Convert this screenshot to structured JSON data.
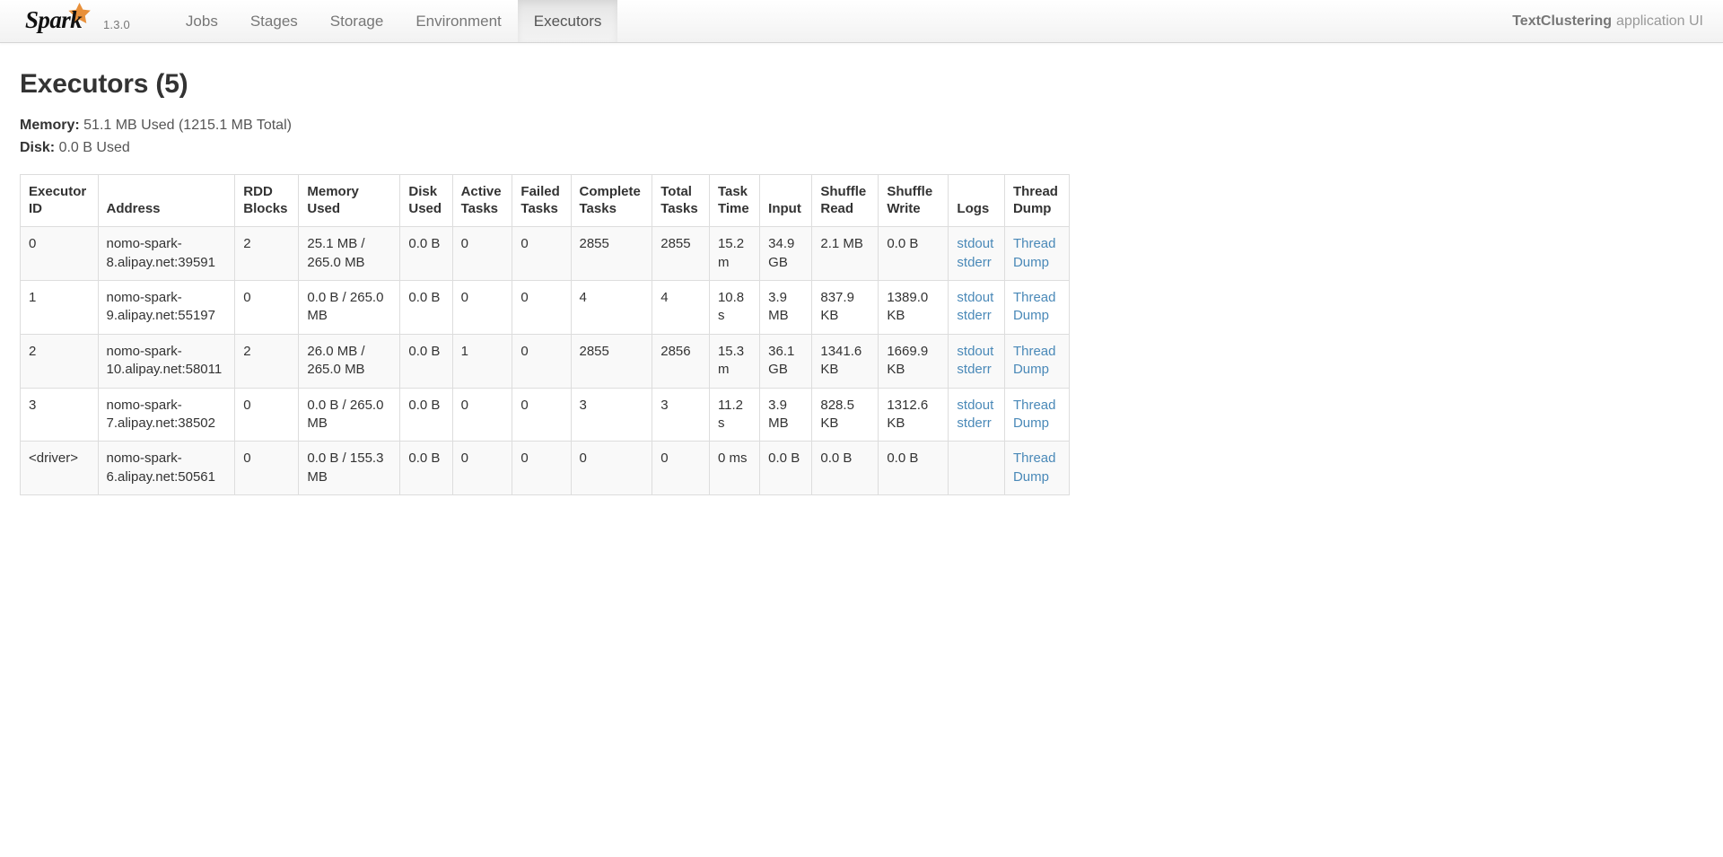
{
  "navbar": {
    "brand": {
      "name": "Spark",
      "version": "1.3.0",
      "logo_icon": "spark-star-logo",
      "star_color": "#e8903a",
      "wordmark_color": "#1a1a1a"
    },
    "tabs": [
      {
        "label": "Jobs",
        "active": false
      },
      {
        "label": "Stages",
        "active": false
      },
      {
        "label": "Storage",
        "active": false
      },
      {
        "label": "Environment",
        "active": false
      },
      {
        "label": "Executors",
        "active": true
      }
    ],
    "app_title": {
      "app_name": "TextClustering",
      "suffix": "application UI"
    }
  },
  "page": {
    "title": "Executors (5)",
    "memory_label": "Memory:",
    "memory_value": "51.1 MB Used (1215.1 MB Total)",
    "disk_label": "Disk:",
    "disk_value": "0.0 B Used"
  },
  "table": {
    "headers": [
      "Executor ID",
      "Address",
      "RDD Blocks",
      "Memory Used",
      "Disk Used",
      "Active Tasks",
      "Failed Tasks",
      "Complete Tasks",
      "Total Tasks",
      "Task Time",
      "Input",
      "Shuffle Read",
      "Shuffle Write",
      "Logs",
      "Thread Dump"
    ],
    "logs_links": {
      "stdout": "stdout",
      "stderr": "stderr"
    },
    "thread_dump_link": "Thread Dump",
    "link_color": "#4a89b8",
    "rows": [
      {
        "executor_id": "0",
        "address": "nomo-spark-8.alipay.net:39591",
        "rdd_blocks": "2",
        "memory_used": "25.1 MB / 265.0 MB",
        "disk_used": "0.0 B",
        "active_tasks": "0",
        "failed_tasks": "0",
        "complete_tasks": "2855",
        "total_tasks": "2855",
        "task_time": "15.2 m",
        "input": "34.9 GB",
        "shuffle_read": "2.1 MB",
        "shuffle_write": "0.0 B",
        "has_logs": true
      },
      {
        "executor_id": "1",
        "address": "nomo-spark-9.alipay.net:55197",
        "rdd_blocks": "0",
        "memory_used": "0.0 B / 265.0 MB",
        "disk_used": "0.0 B",
        "active_tasks": "0",
        "failed_tasks": "0",
        "complete_tasks": "4",
        "total_tasks": "4",
        "task_time": "10.8 s",
        "input": "3.9 MB",
        "shuffle_read": "837.9 KB",
        "shuffle_write": "1389.0 KB",
        "has_logs": true
      },
      {
        "executor_id": "2",
        "address": "nomo-spark-10.alipay.net:58011",
        "rdd_blocks": "2",
        "memory_used": "26.0 MB / 265.0 MB",
        "disk_used": "0.0 B",
        "active_tasks": "1",
        "failed_tasks": "0",
        "complete_tasks": "2855",
        "total_tasks": "2856",
        "task_time": "15.3 m",
        "input": "36.1 GB",
        "shuffle_read": "1341.6 KB",
        "shuffle_write": "1669.9 KB",
        "has_logs": true
      },
      {
        "executor_id": "3",
        "address": "nomo-spark-7.alipay.net:38502",
        "rdd_blocks": "0",
        "memory_used": "0.0 B / 265.0 MB",
        "disk_used": "0.0 B",
        "active_tasks": "0",
        "failed_tasks": "0",
        "complete_tasks": "3",
        "total_tasks": "3",
        "task_time": "11.2 s",
        "input": "3.9 MB",
        "shuffle_read": "828.5 KB",
        "shuffle_write": "1312.6 KB",
        "has_logs": true
      },
      {
        "executor_id": "<driver>",
        "address": "nomo-spark-6.alipay.net:50561",
        "rdd_blocks": "0",
        "memory_used": "0.0 B / 155.3 MB",
        "disk_used": "0.0 B",
        "active_tasks": "0",
        "failed_tasks": "0",
        "complete_tasks": "0",
        "total_tasks": "0",
        "task_time": "0 ms",
        "input": "0.0 B",
        "shuffle_read": "0.0 B",
        "shuffle_write": "0.0 B",
        "has_logs": false
      }
    ]
  }
}
